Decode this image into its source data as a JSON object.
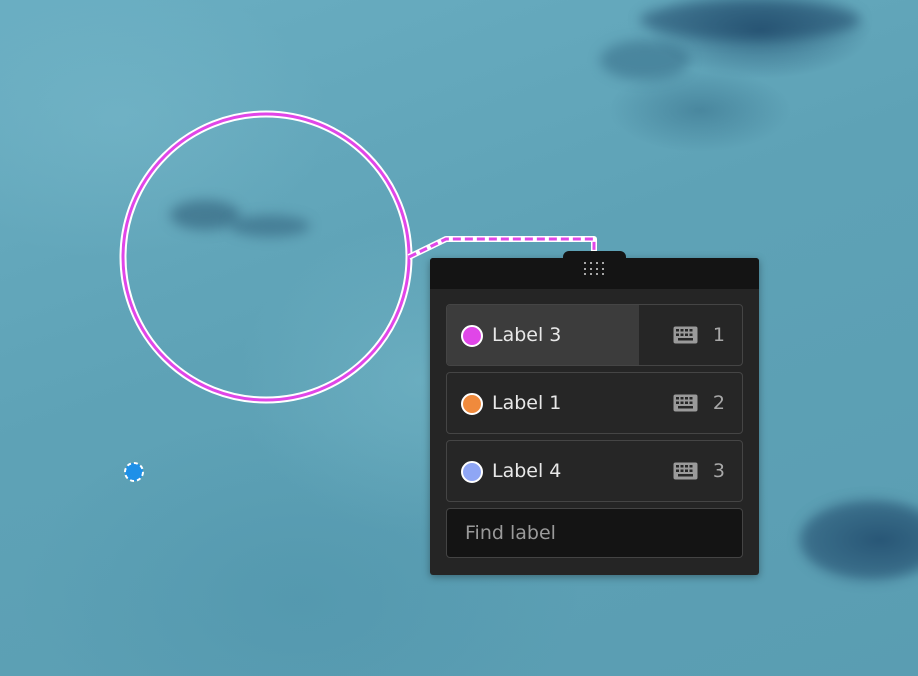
{
  "annotation": {
    "shape": "circle",
    "color": "#e046e8"
  },
  "point_marker": {
    "color": "#1e90e8"
  },
  "label_panel": {
    "drag_handle_icon": "grip-dots-icon",
    "items": [
      {
        "label": "Label 3",
        "color": "#e046e8",
        "hotkey": "1",
        "hotkey_icon": "keyboard-icon",
        "active": true
      },
      {
        "label": "Label 1",
        "color": "#f08a3c",
        "hotkey": "2",
        "hotkey_icon": "keyboard-icon",
        "active": false
      },
      {
        "label": "Label 4",
        "color": "#8fa6f5",
        "hotkey": "3",
        "hotkey_icon": "keyboard-icon",
        "active": false
      }
    ],
    "search": {
      "placeholder": "Find label",
      "value": ""
    }
  }
}
